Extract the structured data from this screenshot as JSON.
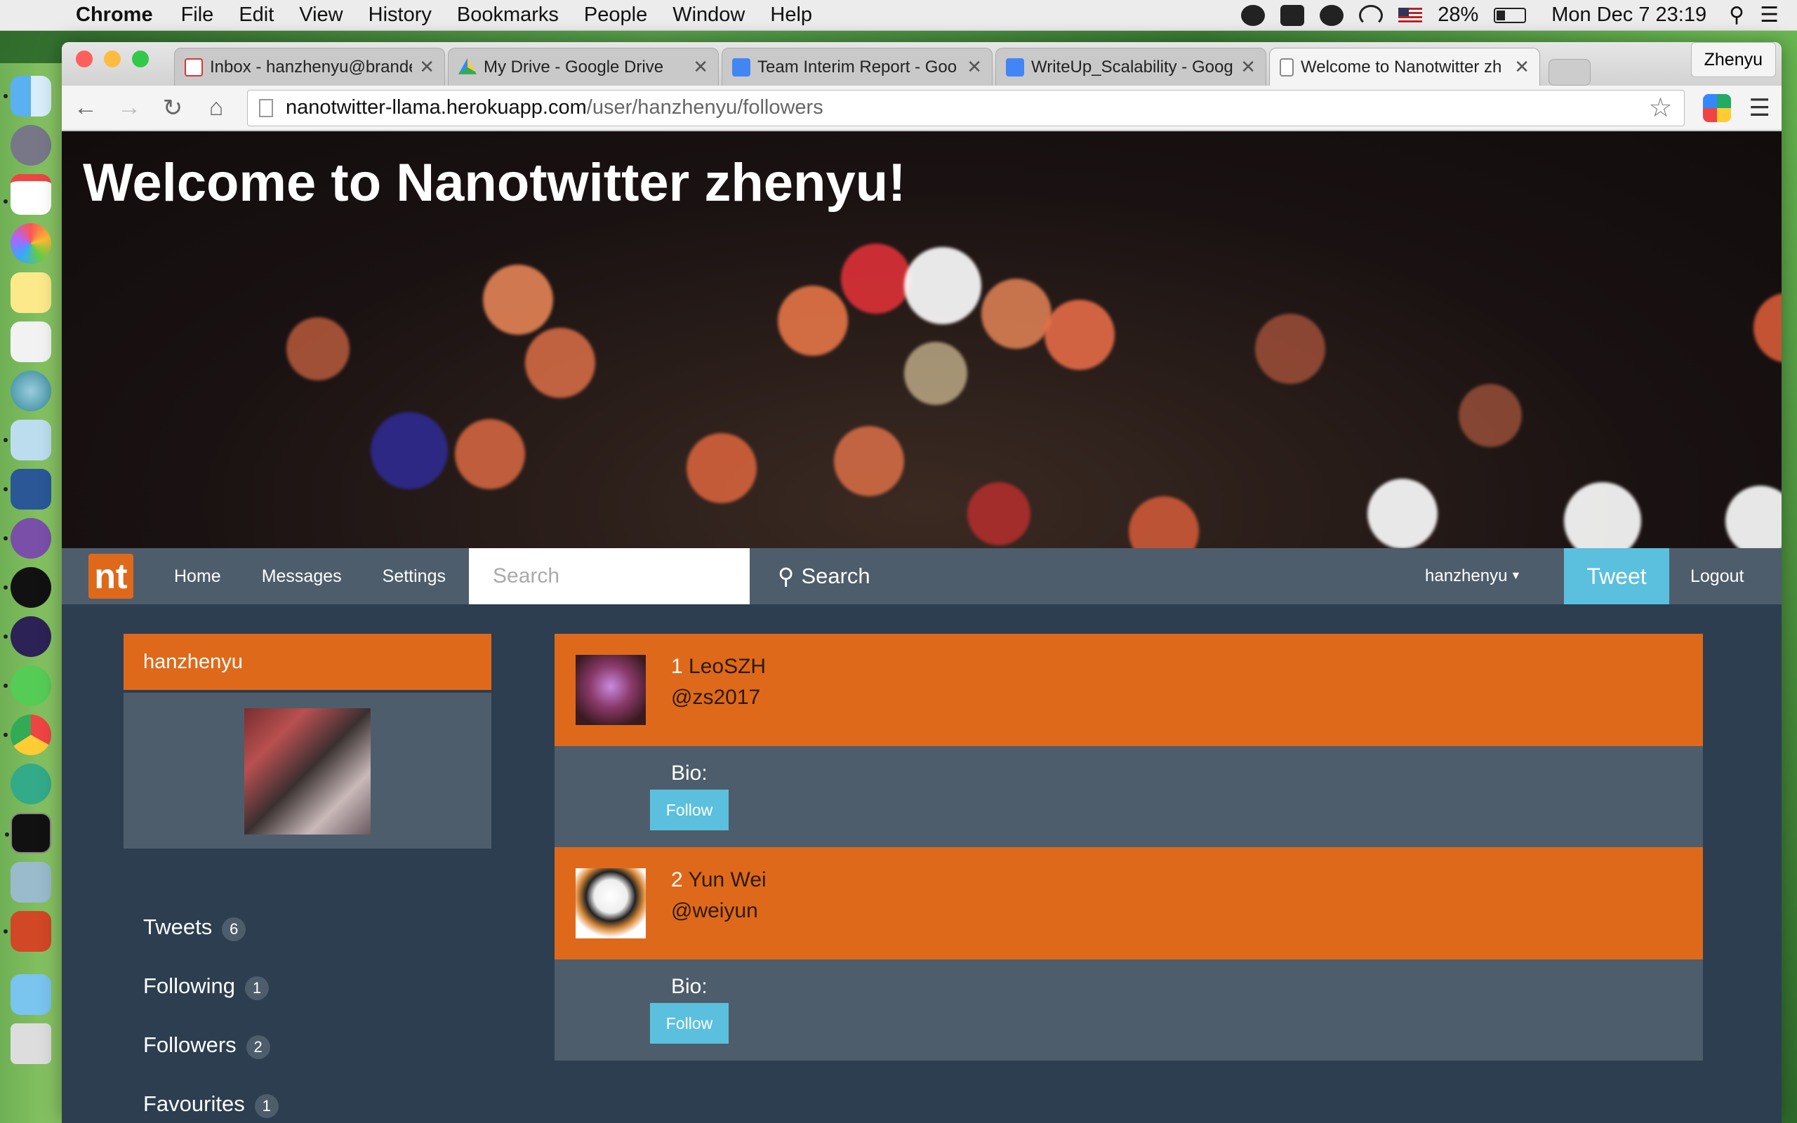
{
  "menubar": {
    "app": "Chrome",
    "items": [
      "File",
      "Edit",
      "View",
      "History",
      "Bookmarks",
      "People",
      "Window",
      "Help"
    ],
    "battery": "28%",
    "clock": "Mon Dec 7  23:19"
  },
  "browser": {
    "tabs": [
      {
        "title": "Inbox - hanzhenyu@brande",
        "icon": "gmail-icon"
      },
      {
        "title": "My Drive - Google Drive",
        "icon": "google-drive-icon"
      },
      {
        "title": "Team Interim Report - Goo",
        "icon": "google-docs-icon"
      },
      {
        "title": "WriteUp_Scalability - Goog",
        "icon": "google-docs-icon"
      },
      {
        "title": "Welcome to Nanotwitter zh",
        "icon": "page-icon"
      }
    ],
    "profile": "Zhenyu",
    "url_host": "nanotwitter-llama.herokuapp.com",
    "url_path": "/user/hanzhenyu/followers"
  },
  "page": {
    "hero_title": "Welcome to Nanotwitter zhenyu!",
    "nav": {
      "brand": "nt",
      "links": [
        "Home",
        "Messages",
        "Settings"
      ],
      "search_placeholder": "Search",
      "search_button": "Search",
      "user": "hanzhenyu",
      "tweet": "Tweet",
      "logout": "Logout"
    },
    "sidebar": {
      "username": "hanzhenyu",
      "stats": [
        {
          "label": "Tweets",
          "count": "6"
        },
        {
          "label": "Following",
          "count": "1"
        },
        {
          "label": "Followers",
          "count": "2"
        },
        {
          "label": "Favourites",
          "count": "1"
        }
      ]
    },
    "followers": [
      {
        "index": "1",
        "name": "LeoSZH",
        "handle": "@zs2017",
        "bio_label": "Bio:",
        "follow": "Follow"
      },
      {
        "index": "2",
        "name": "Yun Wei",
        "handle": "@weiyun",
        "bio_label": "Bio:",
        "follow": "Follow"
      }
    ]
  }
}
